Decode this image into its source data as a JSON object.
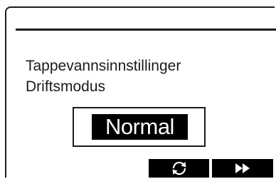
{
  "display": {
    "setting_title": "Tappevannsinnstillinger",
    "setting_subtitle": "Driftsmodus",
    "selected_value": "Normal"
  },
  "softkeys": [
    {
      "icon": "refresh-icon"
    },
    {
      "icon": "fast-forward-icon"
    }
  ],
  "colors": {
    "background": "#ffffff",
    "foreground": "#000000",
    "highlight_text": "#ffffff"
  }
}
